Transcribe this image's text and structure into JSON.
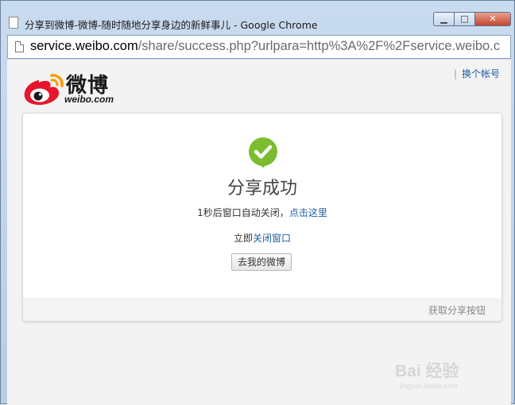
{
  "window": {
    "title": "分享到微博-微博-随时随地分享身边的新鲜事儿 - Google Chrome",
    "buttons": {
      "minimize": "▁",
      "maximize": "□",
      "close": "✕"
    }
  },
  "address": {
    "host": "service.weibo.com",
    "path": "/share/success.php?urlpara=http%3A%2F%2Fservice.weibo.c"
  },
  "header": {
    "logo_text": "微博",
    "logo_sub": "weibo.com",
    "separator": "|",
    "switch_account": "换个帐号"
  },
  "card": {
    "title": "分享成功",
    "countdown_prefix": "1秒后窗口自动关闭，",
    "countdown_link": "点击这里",
    "close_prefix": "立即",
    "close_link": "关闭窗口",
    "my_weibo_button": "去我的微博",
    "footer_link": "获取分享按钮"
  },
  "watermark": {
    "text": "Bai 经验",
    "sub": "jingyan.baidu.com"
  },
  "colors": {
    "success_green": "#7bbd2f",
    "link_blue": "#1f5fa0",
    "weibo_red": "#e6162d",
    "weibo_orange": "#ff9900"
  }
}
